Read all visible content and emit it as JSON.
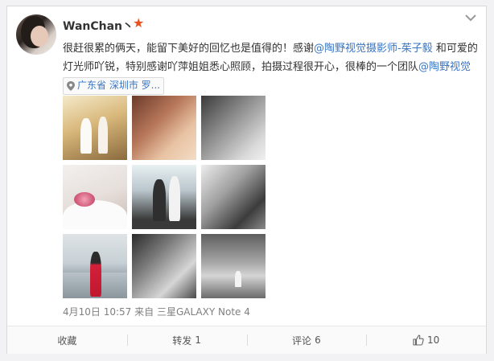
{
  "post": {
    "username": "WanChan丶",
    "text_part1": "很赶很累的俩天，能留下美好的回忆也是值得的！感谢",
    "mention1": "@陶野视觉摄影师-茱子毅",
    "text_part2": " 和可爱的灯光师吖锐，特别感谢吖萍姐姐悉心照顾，拍摄过程很开心，很棒的一个团队",
    "mention2": "@陶野视觉",
    "location": "广东省 深圳市 罗...",
    "images": [
      {
        "icon": "wedding-photo"
      },
      {
        "icon": "wedding-photo"
      },
      {
        "icon": "wedding-photo"
      },
      {
        "icon": "wedding-photo"
      },
      {
        "icon": "wedding-photo"
      },
      {
        "icon": "wedding-photo"
      },
      {
        "icon": "wedding-photo"
      },
      {
        "icon": "wedding-photo"
      },
      {
        "icon": "wedding-photo"
      }
    ],
    "date": "4月10日 10:57",
    "source_prefix": " 来自 ",
    "source": "三星GALAXY Note 4"
  },
  "actions": {
    "favorite": "收藏",
    "repost_label": "转发",
    "repost_count": "1",
    "comment_label": "评论",
    "comment_count": "6",
    "like_count": "10"
  },
  "colors": {
    "link": "#3975c3",
    "verify_star": "#e8501f"
  }
}
